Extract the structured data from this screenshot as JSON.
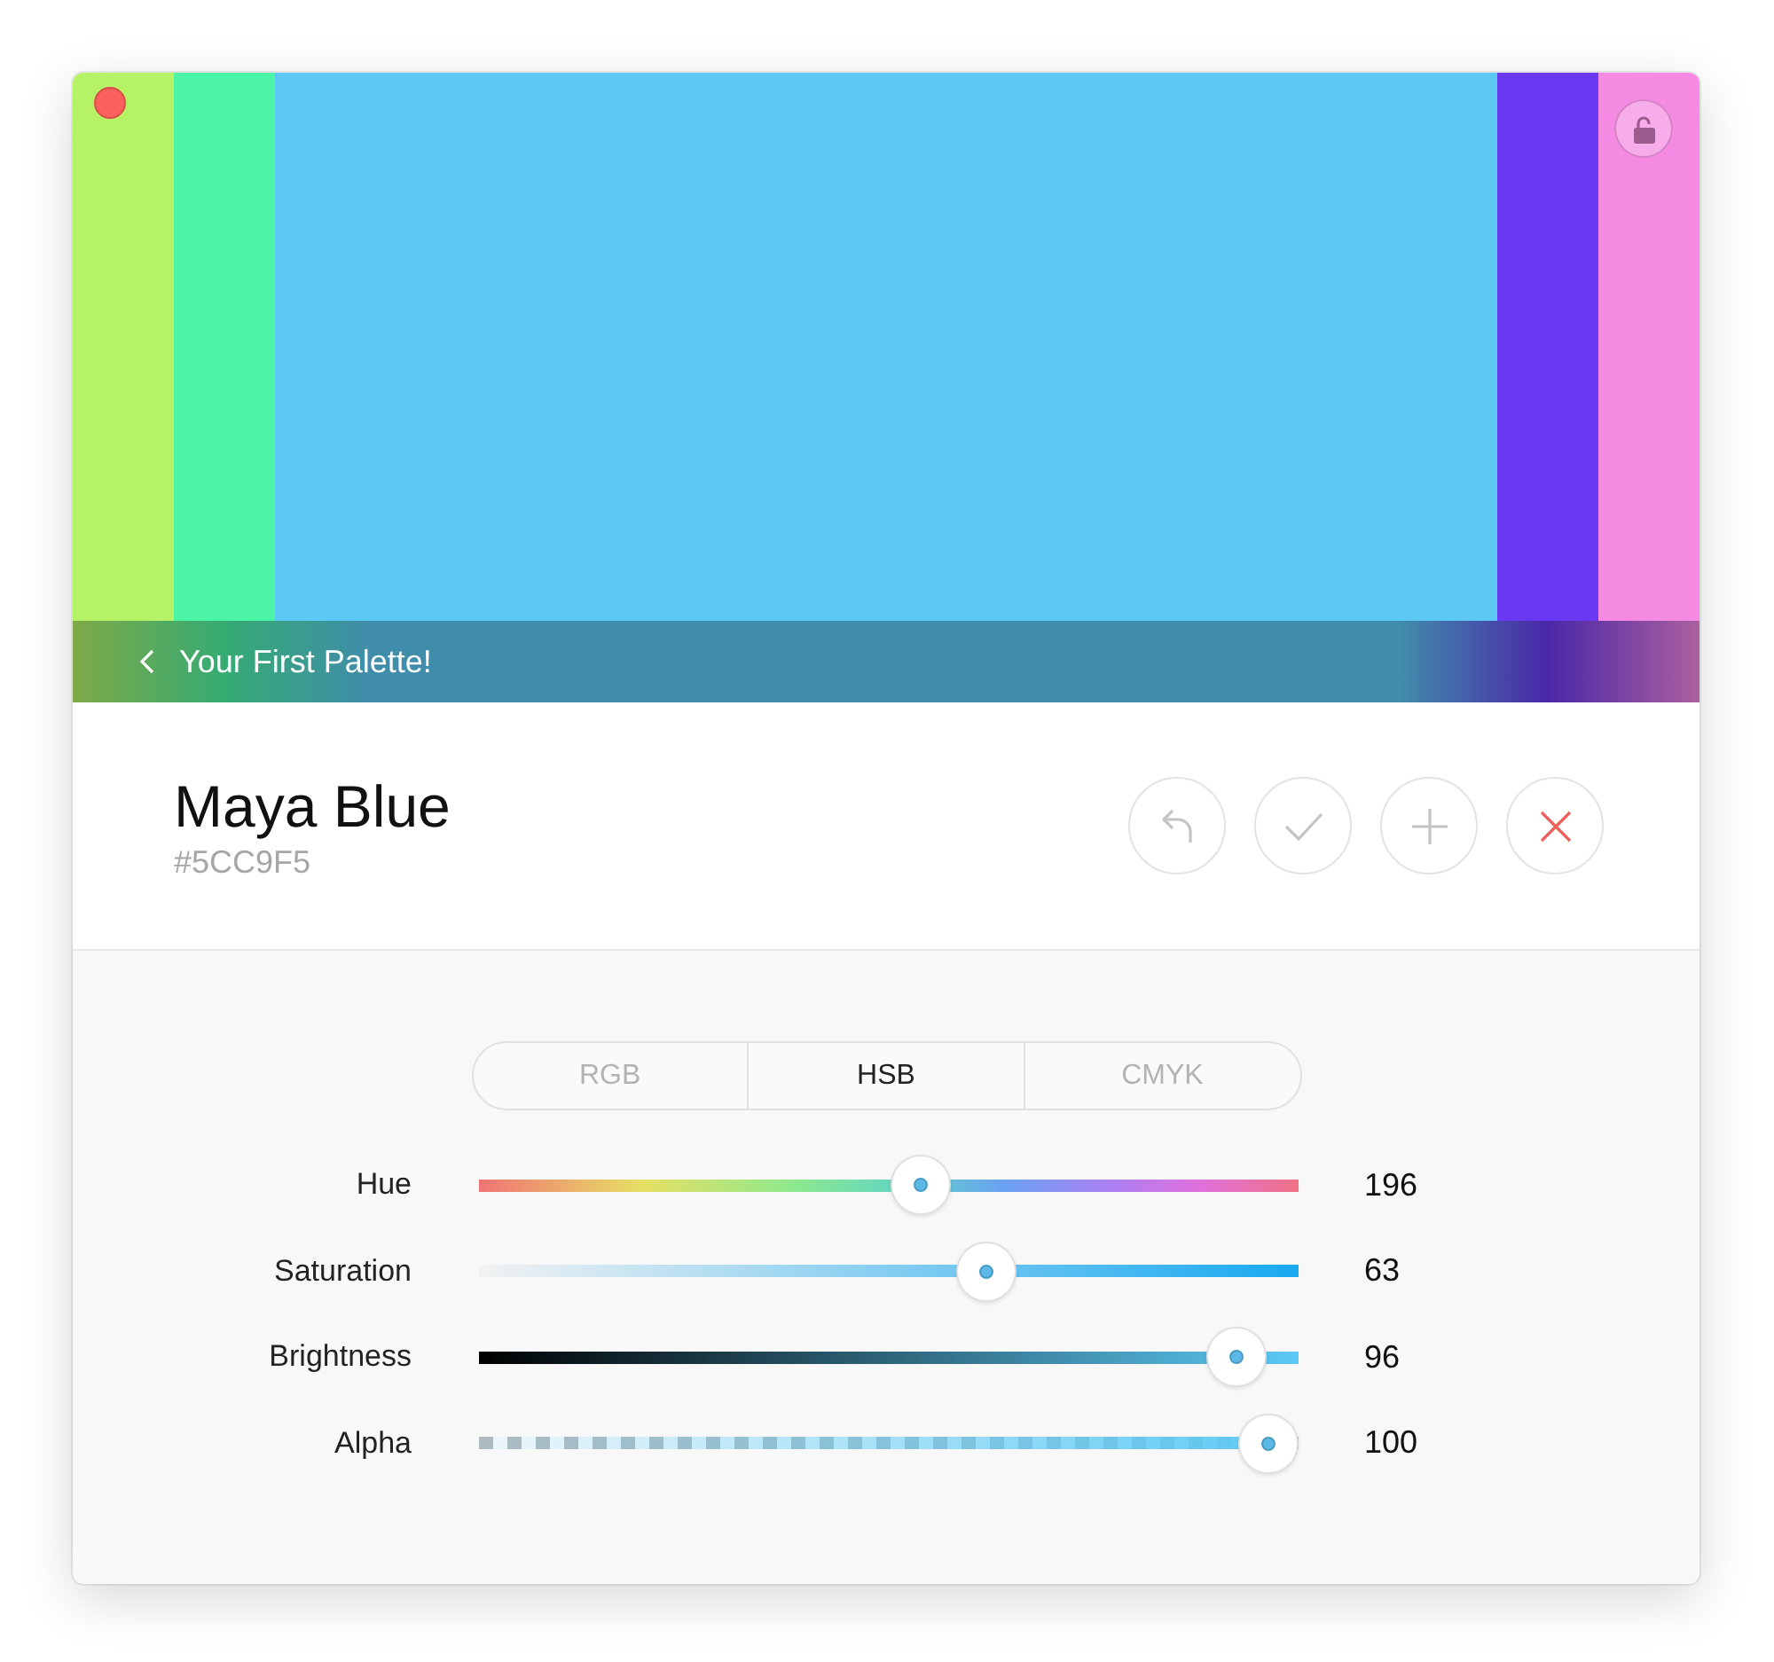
{
  "palette": {
    "title": "Your First Palette!",
    "swatches": [
      {
        "color": "#b5f266",
        "selected": false
      },
      {
        "color": "#4cf5a5",
        "selected": false
      },
      {
        "color": "#5cc9f5",
        "selected": true
      },
      {
        "color": "#6a38f0",
        "selected": false
      },
      {
        "color": "#f58ae3",
        "selected": false
      }
    ]
  },
  "color": {
    "name": "Maya Blue",
    "hex": "#5CC9F5"
  },
  "tabs": [
    {
      "label": "RGB",
      "selected": false
    },
    {
      "label": "HSB",
      "selected": true
    },
    {
      "label": "CMYK",
      "selected": false
    }
  ],
  "sliders": [
    {
      "label": "Hue",
      "kind": "hue",
      "level": 0.544,
      "value": "196"
    },
    {
      "label": "Saturation",
      "kind": "saturation",
      "level": 0.63,
      "value": "63"
    },
    {
      "label": "Brightness",
      "kind": "brightness",
      "level": 0.96,
      "value": "96"
    },
    {
      "label": "Alpha",
      "kind": "alpha",
      "level": 1,
      "value": "100"
    }
  ]
}
